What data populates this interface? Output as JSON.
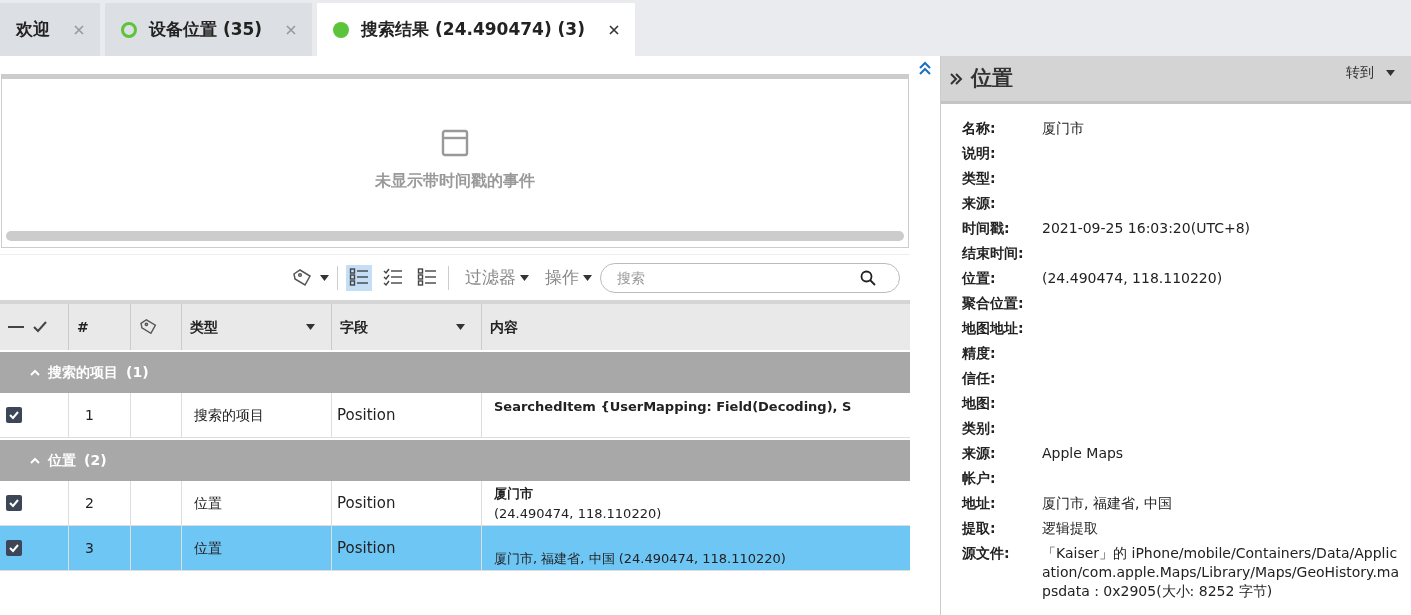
{
  "tabs": [
    {
      "label": "欢迎",
      "selected": false,
      "kind": "plain"
    },
    {
      "label": "设备位置 (35)",
      "selected": false,
      "kind": "ring"
    },
    {
      "label": "搜索结果 (24.490474) (3)",
      "selected": true,
      "kind": "dot"
    }
  ],
  "timeline": {
    "empty_text": "未显示带时间戳的事件"
  },
  "toolbar": {
    "view_modes": [
      {
        "selected": true
      },
      {
        "selected": false
      },
      {
        "selected": false
      }
    ],
    "filter": "过滤器",
    "actions": "操作",
    "search": {
      "placeholder": "搜索"
    }
  },
  "table": {
    "columns": [
      "#",
      "类型",
      "字段",
      "内容"
    ],
    "groups": [
      {
        "label": "搜索的项目",
        "count": "(1)",
        "expanded": true,
        "rows": [
          {
            "checked": true,
            "selected": false,
            "number": "1",
            "type": "搜索的项目",
            "field": "Position",
            "content_title": "SearchedItem {UserMapping: Field(Decoding), S"
          }
        ]
      },
      {
        "label": "位置",
        "count": "(2)",
        "expanded": true,
        "rows": [
          {
            "checked": true,
            "selected": false,
            "number": "2",
            "type": "位置",
            "field": "Position",
            "content_title": "厦门市",
            "content_detail": "(24.490474, 118.110220)"
          },
          {
            "checked": true,
            "selected": true,
            "number": "3",
            "type": "位置",
            "field": "Position",
            "content_detail": "厦门市, 福建省, 中国 (24.490474, 118.110220)"
          }
        ]
      }
    ]
  },
  "details": {
    "title": "位置",
    "goto": "转到",
    "fields": [
      {
        "label": "名称:",
        "value": "厦门市"
      },
      {
        "label": "说明:"
      },
      {
        "label": "类型:"
      },
      {
        "label": "来源:"
      },
      {
        "label": "时间戳:",
        "value": "2021-09-25 16:03:20(UTC+8)"
      },
      {
        "label": "结束时间:"
      },
      {
        "label": "位置:",
        "value": "(24.490474, 118.110220)"
      },
      {
        "label": "聚合位置:"
      },
      {
        "label": "地图地址:"
      },
      {
        "label": "精度:"
      },
      {
        "label": "信任:"
      },
      {
        "label": "地图:"
      },
      {
        "label": "类别:"
      },
      {
        "label": "来源:",
        "value": "Apple Maps"
      },
      {
        "label": "帐户:"
      },
      {
        "label": "地址:",
        "value": "厦门市, 福建省, 中国"
      },
      {
        "label": "提取:",
        "value": "逻辑提取"
      },
      {
        "label": "源文件:",
        "value": "「Kaiser」的 iPhone/mobile/Containers/Data/Application/com.apple.Maps/Library/Maps/GeoHistory.mapsdata : 0x2905(大小: 8252 字节)"
      }
    ]
  }
}
